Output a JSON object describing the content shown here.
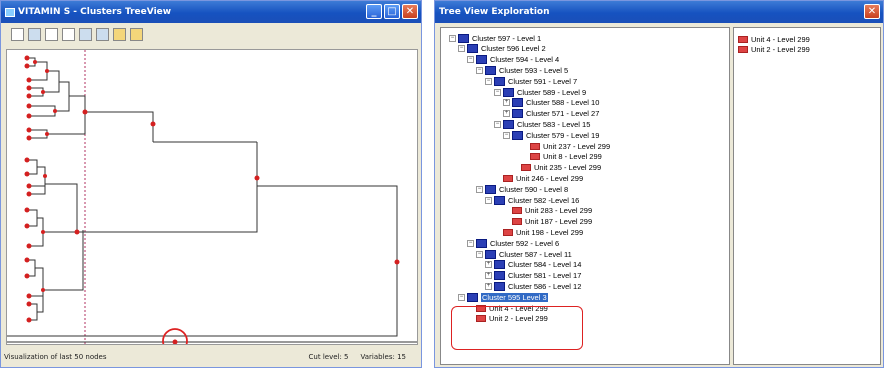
{
  "left_window": {
    "title": "VITAMIN S - Clusters TreeView",
    "status": {
      "left": "Visualization of last 50 nodes",
      "cut_level": "Cut level: 5",
      "variables": "Variables: 15"
    },
    "toolbar_icons": [
      "list-icon",
      "arrow-icon",
      "grid-icon",
      "window-icon",
      "copy-icon",
      "tree-icon",
      "doc-icon",
      "doc-alt-icon"
    ]
  },
  "right_window": {
    "title": "Tree View Exploration",
    "tree": [
      {
        "label": "Cluster 597 - Level 1",
        "indent": 0,
        "pm": "-",
        "icon": "cluster"
      },
      {
        "label": "Cluster 596 Level 2",
        "indent": 1,
        "pm": "-",
        "icon": "cluster"
      },
      {
        "label": "Cluster 594 - Level 4",
        "indent": 2,
        "pm": "-",
        "icon": "cluster"
      },
      {
        "label": "Cluster 593 - Level 5",
        "indent": 3,
        "pm": "-",
        "icon": "cluster"
      },
      {
        "label": "Cluster 591 - Level 7",
        "indent": 4,
        "pm": "-",
        "icon": "cluster"
      },
      {
        "label": "Cluster 589 - Level 9",
        "indent": 5,
        "pm": "-",
        "icon": "cluster"
      },
      {
        "label": "Cluster 588 - Level 10",
        "indent": 6,
        "pm": "+",
        "icon": "cluster"
      },
      {
        "label": "Cluster 571 - Level 27",
        "indent": 6,
        "pm": "+",
        "icon": "cluster"
      },
      {
        "label": "Cluster 583 - Level 15",
        "indent": 5,
        "pm": "-",
        "icon": "cluster"
      },
      {
        "label": "Cluster 579 - Level 19",
        "indent": 6,
        "pm": "-",
        "icon": "cluster"
      },
      {
        "label": "Unit 237 - Level 299",
        "indent": 8,
        "pm": "",
        "icon": "unit"
      },
      {
        "label": "Unit 8 - Level 299",
        "indent": 8,
        "pm": "",
        "icon": "unit"
      },
      {
        "label": "Unit 235 - Level 299",
        "indent": 7,
        "pm": "",
        "icon": "unit"
      },
      {
        "label": "Unit 246 - Level 299",
        "indent": 5,
        "pm": "",
        "icon": "unit"
      },
      {
        "label": "Cluster 590 - Level 8",
        "indent": 3,
        "pm": "-",
        "icon": "cluster"
      },
      {
        "label": "Cluster 582 -Level 16",
        "indent": 4,
        "pm": "-",
        "icon": "cluster"
      },
      {
        "label": "Unit 283 - Level 299",
        "indent": 6,
        "pm": "",
        "icon": "unit"
      },
      {
        "label": "Unit 187 - Level 299",
        "indent": 6,
        "pm": "",
        "icon": "unit"
      },
      {
        "label": "Unit 198 - Level 299",
        "indent": 5,
        "pm": "",
        "icon": "unit"
      },
      {
        "label": "Cluster 592 - Level 6",
        "indent": 2,
        "pm": "-",
        "icon": "cluster"
      },
      {
        "label": "Cluster 587 - Level 11",
        "indent": 3,
        "pm": "-",
        "icon": "cluster"
      },
      {
        "label": "Cluster 584 - Level 14",
        "indent": 4,
        "pm": "+",
        "icon": "cluster"
      },
      {
        "label": "Cluster 581 - Level 17",
        "indent": 4,
        "pm": "+",
        "icon": "cluster"
      },
      {
        "label": "Cluster 586 - Level 12",
        "indent": 4,
        "pm": "+",
        "icon": "cluster"
      },
      {
        "label": "Cluster 595 Level 3",
        "indent": 1,
        "pm": "-",
        "icon": "cluster",
        "selected": true
      },
      {
        "label": "Unit 4 - Level 299",
        "indent": 2,
        "pm": "",
        "icon": "unit"
      },
      {
        "label": "Unit 2 - Level 299",
        "indent": 2,
        "pm": "",
        "icon": "unit"
      }
    ],
    "right_list": [
      "Unit 4 - Level 299",
      "Unit 2 - Level 299"
    ]
  },
  "colors": {
    "accent": "#316ac5",
    "highlight": "#dd2222"
  }
}
